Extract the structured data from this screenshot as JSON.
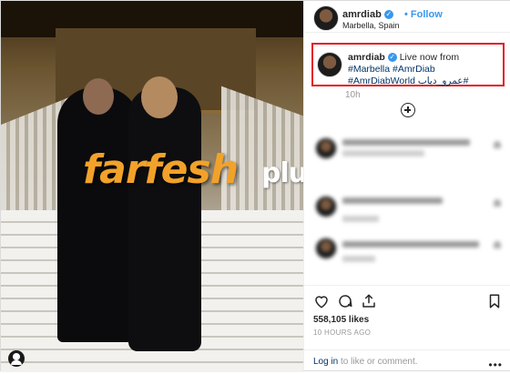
{
  "header": {
    "username": "amrdiab",
    "follow_label": "Follow",
    "location": "Marbella, Spain"
  },
  "caption": {
    "username": "amrdiab",
    "text": "Live now from",
    "hashtags": [
      "#Marbella",
      "#AmrDiab",
      "#AmrDiabWorld",
      "#عمرو_دياب"
    ],
    "time": "10h"
  },
  "watermark": {
    "brand_part1": "farfesh",
    "brand_part2": "plus.com",
    "brand_color": "#f2a22a"
  },
  "actions": {
    "likes": "558,105 likes",
    "posted_ago": "10 HOURS AGO",
    "login_link": "Log in",
    "login_rest": " to like or comment.",
    "more_label": "•••"
  },
  "colors": {
    "link": "#003569",
    "verified": "#3897f0",
    "highlight_border": "#e21b23"
  },
  "icons": [
    "heart-icon",
    "comment-icon",
    "share-icon",
    "bookmark-icon",
    "add-comments-icon",
    "tag-user-icon",
    "verified-icon"
  ]
}
